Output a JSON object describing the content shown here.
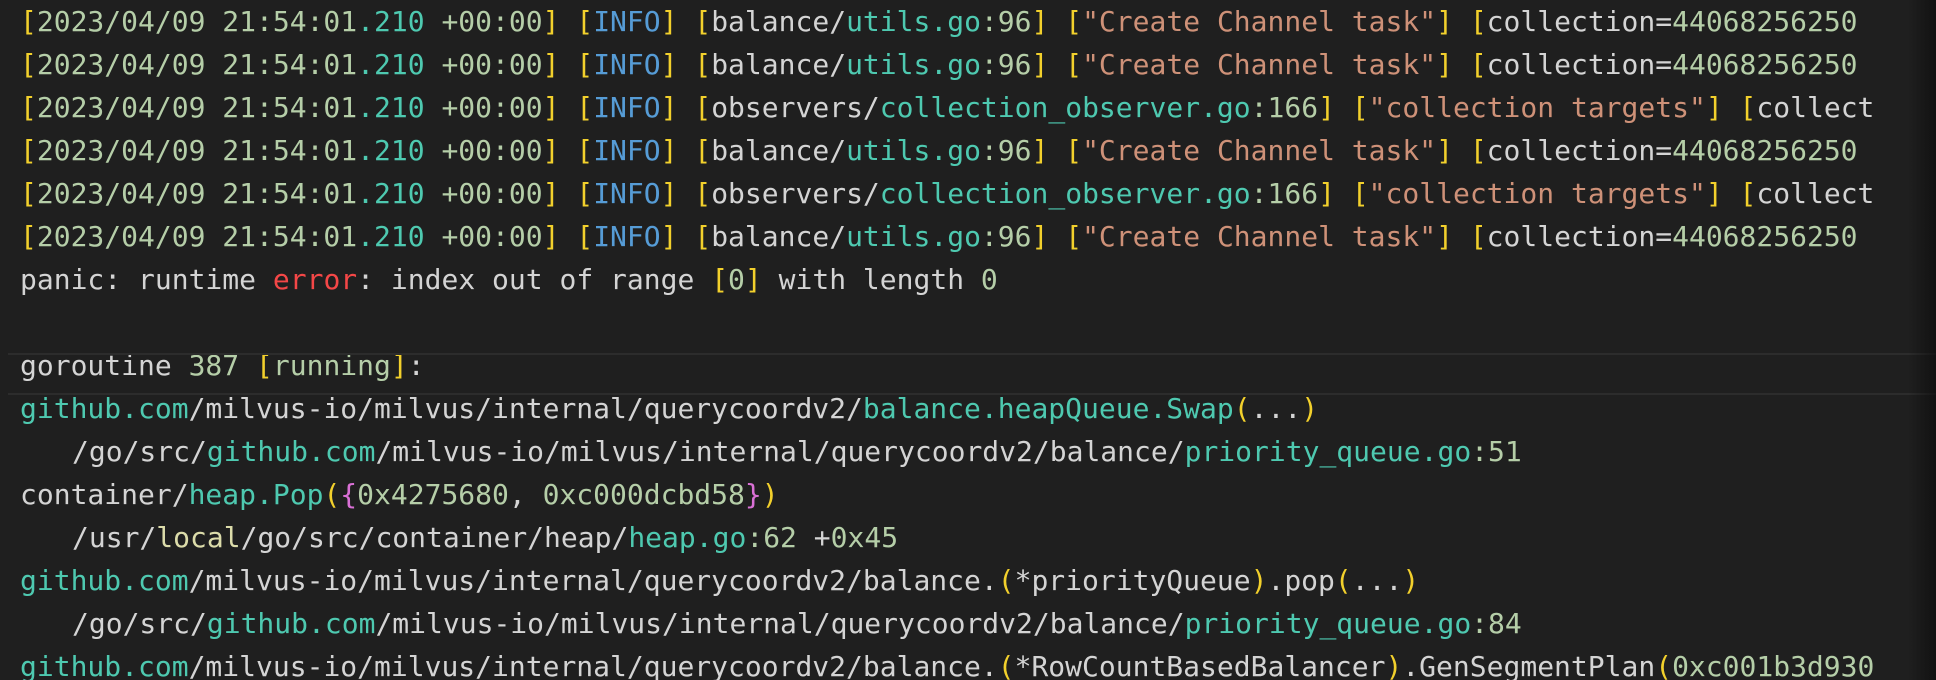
{
  "colors": {
    "background": "#1f1f1f",
    "default": "#d4d4d4",
    "yellow": "#f2d02c",
    "green": "#b5cea8",
    "teal": "#4ec9b0",
    "blue": "#569cd6",
    "orange": "#ce9178",
    "red": "#f44747",
    "pink": "#da70d6",
    "olive": "#dcdcaa"
  },
  "lines": [
    {
      "segments": [
        {
          "t": "[",
          "c": "yellow"
        },
        {
          "t": "2023/04/09 21:54:01",
          "c": "green"
        },
        {
          "t": ".210",
          "c": "teal"
        },
        {
          "t": " +00:00",
          "c": "green"
        },
        {
          "t": "]",
          "c": "yellow"
        },
        {
          "t": " ",
          "c": "default"
        },
        {
          "t": "[",
          "c": "yellow"
        },
        {
          "t": "INFO",
          "c": "blue"
        },
        {
          "t": "]",
          "c": "yellow"
        },
        {
          "t": " ",
          "c": "default"
        },
        {
          "t": "[",
          "c": "yellow"
        },
        {
          "t": "balance/",
          "c": "default"
        },
        {
          "t": "utils.go",
          "c": "teal"
        },
        {
          "t": ":96",
          "c": "green"
        },
        {
          "t": "]",
          "c": "yellow"
        },
        {
          "t": " ",
          "c": "default"
        },
        {
          "t": "[",
          "c": "yellow"
        },
        {
          "t": "\"Create Channel task\"",
          "c": "orange"
        },
        {
          "t": "]",
          "c": "yellow"
        },
        {
          "t": " ",
          "c": "default"
        },
        {
          "t": "[",
          "c": "yellow"
        },
        {
          "t": "collection=",
          "c": "default"
        },
        {
          "t": "44068256250",
          "c": "green"
        }
      ]
    },
    {
      "segments": [
        {
          "t": "[",
          "c": "yellow"
        },
        {
          "t": "2023/04/09 21:54:01",
          "c": "green"
        },
        {
          "t": ".210",
          "c": "teal"
        },
        {
          "t": " +00:00",
          "c": "green"
        },
        {
          "t": "]",
          "c": "yellow"
        },
        {
          "t": " ",
          "c": "default"
        },
        {
          "t": "[",
          "c": "yellow"
        },
        {
          "t": "INFO",
          "c": "blue"
        },
        {
          "t": "]",
          "c": "yellow"
        },
        {
          "t": " ",
          "c": "default"
        },
        {
          "t": "[",
          "c": "yellow"
        },
        {
          "t": "balance/",
          "c": "default"
        },
        {
          "t": "utils.go",
          "c": "teal"
        },
        {
          "t": ":96",
          "c": "green"
        },
        {
          "t": "]",
          "c": "yellow"
        },
        {
          "t": " ",
          "c": "default"
        },
        {
          "t": "[",
          "c": "yellow"
        },
        {
          "t": "\"Create Channel task\"",
          "c": "orange"
        },
        {
          "t": "]",
          "c": "yellow"
        },
        {
          "t": " ",
          "c": "default"
        },
        {
          "t": "[",
          "c": "yellow"
        },
        {
          "t": "collection=",
          "c": "default"
        },
        {
          "t": "44068256250",
          "c": "green"
        }
      ]
    },
    {
      "segments": [
        {
          "t": "[",
          "c": "yellow"
        },
        {
          "t": "2023/04/09 21:54:01",
          "c": "green"
        },
        {
          "t": ".210",
          "c": "teal"
        },
        {
          "t": " +00:00",
          "c": "green"
        },
        {
          "t": "]",
          "c": "yellow"
        },
        {
          "t": " ",
          "c": "default"
        },
        {
          "t": "[",
          "c": "yellow"
        },
        {
          "t": "INFO",
          "c": "blue"
        },
        {
          "t": "]",
          "c": "yellow"
        },
        {
          "t": " ",
          "c": "default"
        },
        {
          "t": "[",
          "c": "yellow"
        },
        {
          "t": "observers/",
          "c": "default"
        },
        {
          "t": "collection_observer.go",
          "c": "teal"
        },
        {
          "t": ":166",
          "c": "green"
        },
        {
          "t": "]",
          "c": "yellow"
        },
        {
          "t": " ",
          "c": "default"
        },
        {
          "t": "[",
          "c": "yellow"
        },
        {
          "t": "\"collection targets\"",
          "c": "orange"
        },
        {
          "t": "]",
          "c": "yellow"
        },
        {
          "t": " ",
          "c": "default"
        },
        {
          "t": "[",
          "c": "yellow"
        },
        {
          "t": "collect",
          "c": "default"
        }
      ]
    },
    {
      "segments": [
        {
          "t": "[",
          "c": "yellow"
        },
        {
          "t": "2023/04/09 21:54:01",
          "c": "green"
        },
        {
          "t": ".210",
          "c": "teal"
        },
        {
          "t": " +00:00",
          "c": "green"
        },
        {
          "t": "]",
          "c": "yellow"
        },
        {
          "t": " ",
          "c": "default"
        },
        {
          "t": "[",
          "c": "yellow"
        },
        {
          "t": "INFO",
          "c": "blue"
        },
        {
          "t": "]",
          "c": "yellow"
        },
        {
          "t": " ",
          "c": "default"
        },
        {
          "t": "[",
          "c": "yellow"
        },
        {
          "t": "balance/",
          "c": "default"
        },
        {
          "t": "utils.go",
          "c": "teal"
        },
        {
          "t": ":96",
          "c": "green"
        },
        {
          "t": "]",
          "c": "yellow"
        },
        {
          "t": " ",
          "c": "default"
        },
        {
          "t": "[",
          "c": "yellow"
        },
        {
          "t": "\"Create Channel task\"",
          "c": "orange"
        },
        {
          "t": "]",
          "c": "yellow"
        },
        {
          "t": " ",
          "c": "default"
        },
        {
          "t": "[",
          "c": "yellow"
        },
        {
          "t": "collection=",
          "c": "default"
        },
        {
          "t": "44068256250",
          "c": "green"
        }
      ]
    },
    {
      "segments": [
        {
          "t": "[",
          "c": "yellow"
        },
        {
          "t": "2023/04/09 21:54:01",
          "c": "green"
        },
        {
          "t": ".210",
          "c": "teal"
        },
        {
          "t": " +00:00",
          "c": "green"
        },
        {
          "t": "]",
          "c": "yellow"
        },
        {
          "t": " ",
          "c": "default"
        },
        {
          "t": "[",
          "c": "yellow"
        },
        {
          "t": "INFO",
          "c": "blue"
        },
        {
          "t": "]",
          "c": "yellow"
        },
        {
          "t": " ",
          "c": "default"
        },
        {
          "t": "[",
          "c": "yellow"
        },
        {
          "t": "observers/",
          "c": "default"
        },
        {
          "t": "collection_observer.go",
          "c": "teal"
        },
        {
          "t": ":166",
          "c": "green"
        },
        {
          "t": "]",
          "c": "yellow"
        },
        {
          "t": " ",
          "c": "default"
        },
        {
          "t": "[",
          "c": "yellow"
        },
        {
          "t": "\"collection targets\"",
          "c": "orange"
        },
        {
          "t": "]",
          "c": "yellow"
        },
        {
          "t": " ",
          "c": "default"
        },
        {
          "t": "[",
          "c": "yellow"
        },
        {
          "t": "collect",
          "c": "default"
        }
      ]
    },
    {
      "segments": [
        {
          "t": "[",
          "c": "yellow"
        },
        {
          "t": "2023/04/09 21:54:01",
          "c": "green"
        },
        {
          "t": ".210",
          "c": "teal"
        },
        {
          "t": " +00:00",
          "c": "green"
        },
        {
          "t": "]",
          "c": "yellow"
        },
        {
          "t": " ",
          "c": "default"
        },
        {
          "t": "[",
          "c": "yellow"
        },
        {
          "t": "INFO",
          "c": "blue"
        },
        {
          "t": "]",
          "c": "yellow"
        },
        {
          "t": " ",
          "c": "default"
        },
        {
          "t": "[",
          "c": "yellow"
        },
        {
          "t": "balance/",
          "c": "default"
        },
        {
          "t": "utils.go",
          "c": "teal"
        },
        {
          "t": ":96",
          "c": "green"
        },
        {
          "t": "]",
          "c": "yellow"
        },
        {
          "t": " ",
          "c": "default"
        },
        {
          "t": "[",
          "c": "yellow"
        },
        {
          "t": "\"Create Channel task\"",
          "c": "orange"
        },
        {
          "t": "]",
          "c": "yellow"
        },
        {
          "t": " ",
          "c": "default"
        },
        {
          "t": "[",
          "c": "yellow"
        },
        {
          "t": "collection=",
          "c": "default"
        },
        {
          "t": "44068256250",
          "c": "green"
        }
      ]
    },
    {
      "segments": [
        {
          "t": "panic: runtime ",
          "c": "default"
        },
        {
          "t": "error",
          "c": "red"
        },
        {
          "t": ": index out of range ",
          "c": "default"
        },
        {
          "t": "[",
          "c": "yellow"
        },
        {
          "t": "0",
          "c": "green"
        },
        {
          "t": "]",
          "c": "yellow"
        },
        {
          "t": " with length ",
          "c": "default"
        },
        {
          "t": "0",
          "c": "green"
        }
      ]
    },
    {
      "segments": []
    },
    {
      "segments": [
        {
          "t": "goroutine ",
          "c": "default"
        },
        {
          "t": "387",
          "c": "green"
        },
        {
          "t": " ",
          "c": "default"
        },
        {
          "t": "[",
          "c": "yellow"
        },
        {
          "t": "running",
          "c": "green"
        },
        {
          "t": "]",
          "c": "yellow"
        },
        {
          "t": ":",
          "c": "default"
        }
      ]
    },
    {
      "segments": [
        {
          "t": "github.com",
          "c": "teal"
        },
        {
          "t": "/milvus-io/milvus/internal/querycoordv2/",
          "c": "default"
        },
        {
          "t": "balance.heapQueue.Swap",
          "c": "teal"
        },
        {
          "t": "(",
          "c": "yellow"
        },
        {
          "t": "...",
          "c": "default"
        },
        {
          "t": ")",
          "c": "yellow"
        }
      ]
    },
    {
      "indent": true,
      "segments": [
        {
          "t": "/go/src/",
          "c": "default"
        },
        {
          "t": "github.com",
          "c": "teal"
        },
        {
          "t": "/milvus-io/milvus/internal/querycoordv2/balance/",
          "c": "default"
        },
        {
          "t": "priority_queue.go",
          "c": "teal"
        },
        {
          "t": ":51",
          "c": "green"
        }
      ]
    },
    {
      "segments": [
        {
          "t": "container/",
          "c": "default"
        },
        {
          "t": "heap.Pop",
          "c": "teal"
        },
        {
          "t": "(",
          "c": "yellow"
        },
        {
          "t": "{",
          "c": "pink"
        },
        {
          "t": "0x4275680",
          "c": "green"
        },
        {
          "t": ", ",
          "c": "default"
        },
        {
          "t": "0xc000dcbd58",
          "c": "green"
        },
        {
          "t": "}",
          "c": "pink"
        },
        {
          "t": ")",
          "c": "yellow"
        }
      ]
    },
    {
      "indent": true,
      "segments": [
        {
          "t": "/usr/",
          "c": "default"
        },
        {
          "t": "local",
          "c": "olive"
        },
        {
          "t": "/go/src/container/heap/",
          "c": "default"
        },
        {
          "t": "heap.go",
          "c": "teal"
        },
        {
          "t": ":62",
          "c": "green"
        },
        {
          "t": " +",
          "c": "default"
        },
        {
          "t": "0x45",
          "c": "green"
        }
      ]
    },
    {
      "segments": [
        {
          "t": "github.com",
          "c": "teal"
        },
        {
          "t": "/milvus-io/milvus/internal/querycoordv2/balance.",
          "c": "default"
        },
        {
          "t": "(",
          "c": "yellow"
        },
        {
          "t": "*priorityQueue",
          "c": "default"
        },
        {
          "t": ")",
          "c": "yellow"
        },
        {
          "t": ".pop",
          "c": "default"
        },
        {
          "t": "(",
          "c": "yellow"
        },
        {
          "t": "...",
          "c": "default"
        },
        {
          "t": ")",
          "c": "yellow"
        }
      ]
    },
    {
      "indent": true,
      "segments": [
        {
          "t": "/go/src/",
          "c": "default"
        },
        {
          "t": "github.com",
          "c": "teal"
        },
        {
          "t": "/milvus-io/milvus/internal/querycoordv2/balance/",
          "c": "default"
        },
        {
          "t": "priority_queue.go",
          "c": "teal"
        },
        {
          "t": ":84",
          "c": "green"
        }
      ]
    },
    {
      "segments": [
        {
          "t": "github.com",
          "c": "teal"
        },
        {
          "t": "/milvus-io/milvus/internal/querycoordv2/balance.",
          "c": "default"
        },
        {
          "t": "(",
          "c": "yellow"
        },
        {
          "t": "*RowCountBasedBalancer",
          "c": "default"
        },
        {
          "t": ")",
          "c": "yellow"
        },
        {
          "t": ".GenSegmentPlan",
          "c": "default"
        },
        {
          "t": "(",
          "c": "yellow"
        },
        {
          "t": "0xc001b3d930",
          "c": "green"
        }
      ]
    }
  ]
}
